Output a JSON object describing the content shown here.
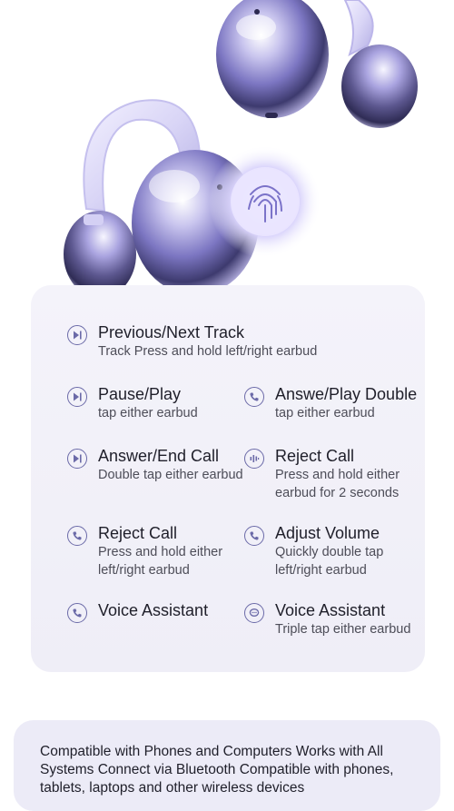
{
  "features": {
    "prev_next": {
      "title": "Previous/Next Track",
      "desc": "Track Press and hold left/right earbud",
      "icon": "play-skip-icon"
    },
    "pause_play": {
      "title": "Pause/Play",
      "desc": "tap either earbud",
      "icon": "play-skip-icon"
    },
    "answer_play_double": {
      "title": "Answe/Play Double",
      "desc": "tap either earbud",
      "icon": "phone-icon"
    },
    "answer_end": {
      "title": "Answer/End Call",
      "desc": "Double tap either earbud",
      "icon": "play-skip-icon"
    },
    "reject_call_right": {
      "title": "Reject Call",
      "desc": "Press and hold either earbud for 2 seconds",
      "icon": "volume-bars-icon"
    },
    "reject_call_left": {
      "title": "Reject Call",
      "desc": "Press and hold either left/right earbud",
      "icon": "phone-icon"
    },
    "adjust_volume": {
      "title": "Adjust Volume",
      "desc": "Quickly double tap left/right earbud",
      "icon": "phone-icon"
    },
    "voice_left": {
      "title": "Voice Assistant",
      "icon": "phone-icon"
    },
    "voice_right": {
      "title": "Voice Assistant",
      "desc": "Triple tap either earbud",
      "icon": "chat-icon"
    }
  },
  "compat": {
    "text": "Compatible with Phones and Computers Works with All Systems Connect via Bluetooth Compatible with phones, tablets, laptops and other wireless devices"
  },
  "colors": {
    "icon": "#6b6aa8",
    "card": "#f1f0f8",
    "bottom_card": "#ecebf7",
    "earbud_purple": "#9a93d8"
  }
}
